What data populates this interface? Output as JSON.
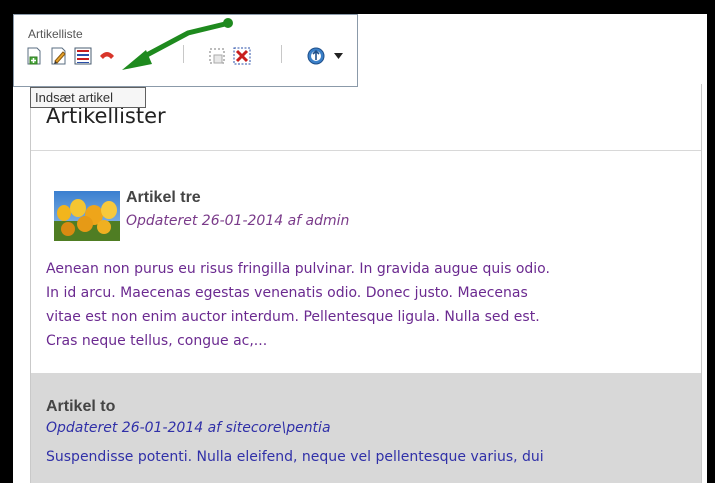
{
  "ribbon": {
    "group_label": "Artikelliste",
    "tooltip": "Indsæt artikel",
    "buttons": [
      {
        "name": "insert-article",
        "icon": "document-add-icon"
      },
      {
        "name": "edit-article",
        "icon": "document-edit-icon"
      },
      {
        "name": "list",
        "icon": "list-icon"
      },
      {
        "name": "remove",
        "icon": "remove-icon"
      },
      {
        "name": "select-area",
        "icon": "selection-icon"
      },
      {
        "name": "delete",
        "icon": "delete-x-icon"
      },
      {
        "name": "navigate",
        "icon": "navigate-circle-icon"
      }
    ]
  },
  "page": {
    "title": "Artikellister"
  },
  "articles": [
    {
      "title": "Artikel tre",
      "meta": "Opdateret 26-01-2014  af  admin",
      "body_lines": [
        "Aenean non purus eu risus fringilla pulvinar. In gravida augue quis odio.",
        "In id arcu. Maecenas egestas venenatis odio. Donec justo. Maecenas",
        "vitae est non enim auctor interdum. Pellentesque ligula. Nulla sed est.",
        "Cras neque tellus, congue ac,..."
      ]
    },
    {
      "title": "Artikel to",
      "meta": "Opdateret 26-01-2014  af  sitecore\\pentia",
      "body_lines": [
        "Suspendisse potenti. Nulla eleifend, neque vel pellentesque varius, dui"
      ]
    }
  ],
  "colors": {
    "arrow": "#1e8a1e",
    "meta_article1": "#7a3b8a",
    "meta_article2": "#3030a8",
    "highlight_bg": "#d8d8d8"
  }
}
